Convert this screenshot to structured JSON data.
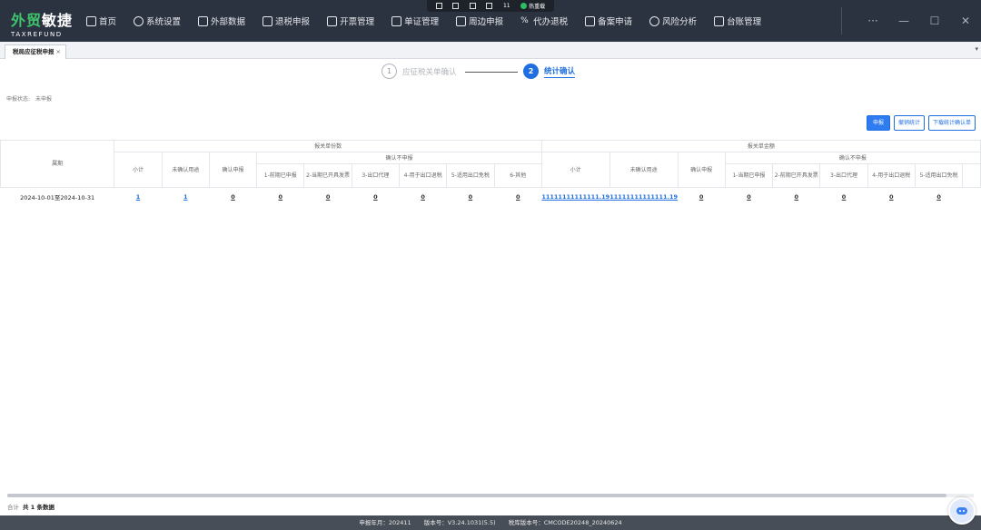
{
  "app": {
    "logo_cn_a": "外贸",
    "logo_cn_b": "敏捷",
    "logo_en": "TAXREFUND"
  },
  "nav": [
    {
      "label": "首页",
      "icon": "home-icon"
    },
    {
      "label": "系统设置",
      "icon": "settings-icon"
    },
    {
      "label": "外部数据",
      "icon": "data-icon"
    },
    {
      "label": "退税申报",
      "icon": "declare-icon"
    },
    {
      "label": "开票管理",
      "icon": "invoice-icon"
    },
    {
      "label": "单证管理",
      "icon": "document-icon"
    },
    {
      "label": "周边申报",
      "icon": "envelope-icon"
    },
    {
      "label": "代办退税",
      "icon": "agent-icon"
    },
    {
      "label": "备案申请",
      "icon": "file-icon"
    },
    {
      "label": "风险分析",
      "icon": "chart-icon"
    },
    {
      "label": "台账管理",
      "icon": "ledger-icon"
    }
  ],
  "window": {
    "more": "···",
    "minimize": "—",
    "maximize": "☐",
    "close": "✕"
  },
  "float_bar": {
    "badge_count": "11",
    "status": "热重载"
  },
  "tab": {
    "label": "税局应征税申报",
    "close": "×"
  },
  "steps": [
    {
      "num": "1",
      "label": "应征税关单确认"
    },
    {
      "num": "2",
      "label": "统计确认"
    }
  ],
  "status": {
    "label": "申报状态:",
    "value": "未申报"
  },
  "actions": {
    "declare": "申报",
    "undo_stats": "撤销统计",
    "download": "下载统计确认单"
  },
  "table": {
    "period_header": "属期",
    "group_count": "报关单份数",
    "group_amount": "报关单金额",
    "not_declared": "确认不申报",
    "subtotal": "小计",
    "unconfirmed": "未确认用途",
    "confirmed": "确认申报",
    "count_sub": [
      "1-前期已申报",
      "2-当期已开具发票",
      "3-出口代理",
      "4-用于出口退税",
      "5-适用出口免税",
      "6-其他"
    ],
    "amount_sub": [
      "1-当期已申报",
      "2-前期已开具发票",
      "3-出口代理",
      "4-用于出口退税",
      "5-适用出口免税"
    ],
    "rows": [
      {
        "period": "2024-10-01至2024-10-31",
        "count_subtotal": "1",
        "count_unconfirmed": "1",
        "count_confirmed": "0",
        "count_nd": [
          "0",
          "0",
          "0",
          "0",
          "0",
          "0"
        ],
        "amt_subtotal": "11111111111111.19",
        "amt_unconfirmed": "11111111111111.19",
        "amt_confirmed": "0",
        "amt_nd": [
          "0",
          "0",
          "0",
          "0",
          "0"
        ]
      }
    ]
  },
  "summary": {
    "label": "合计",
    "value": "共 1 条数据"
  },
  "statusbar": {
    "period": "申报年月：202411",
    "version": "版本号：V3.24.1031(5.5)",
    "db_version": "税库版本号：CMCODE20248_20240624"
  }
}
